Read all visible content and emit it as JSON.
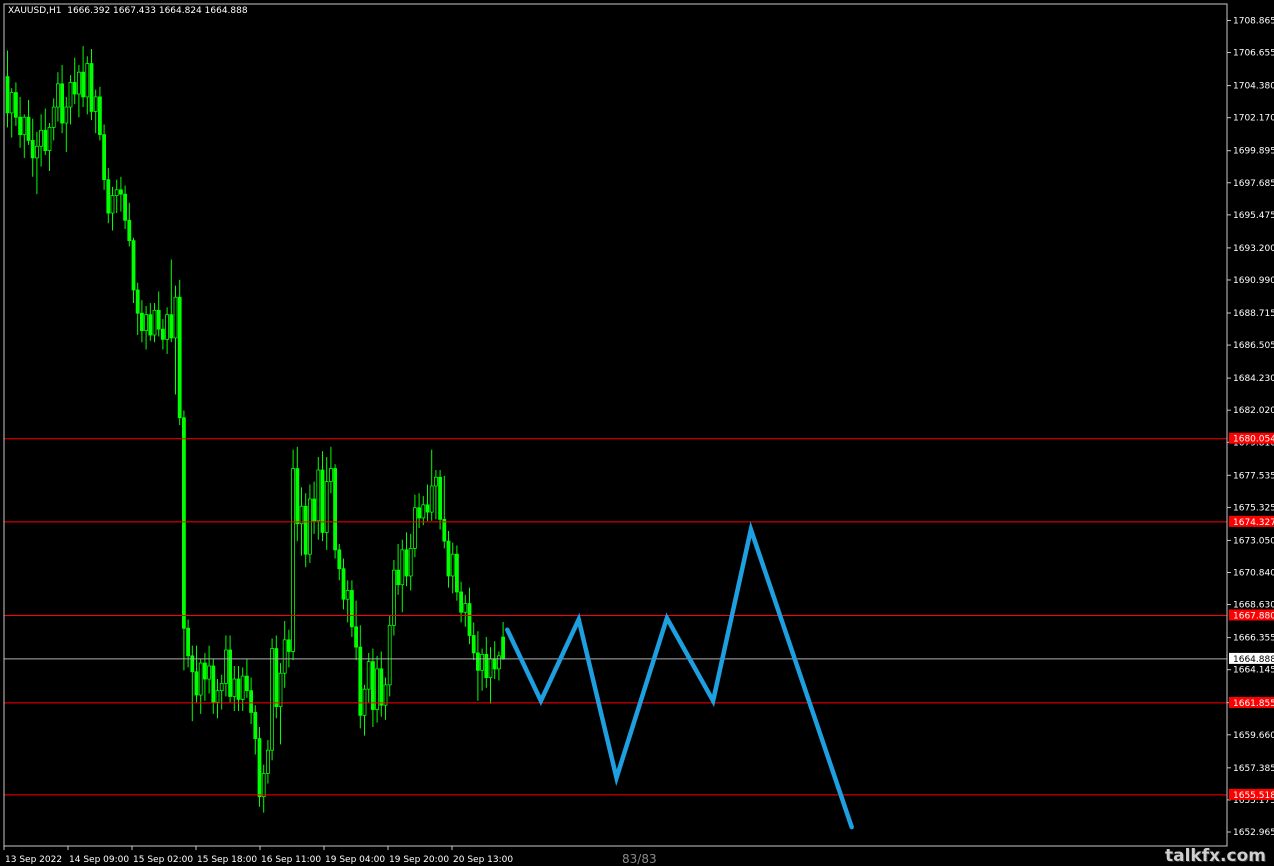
{
  "chart_data": {
    "type": "candlestick",
    "title": "XAUUSD,H1  1666.392 1667.433 1664.824 1664.888",
    "symbol": "XAUUSD,H1",
    "ohlc_label": "1666.392 1667.433 1664.824 1664.888",
    "ylim": [
      1652.0,
      1710.0
    ],
    "y_ticks": [
      "1708.865",
      "1706.655",
      "1704.380",
      "1702.170",
      "1699.895",
      "1697.685",
      "1695.475",
      "1693.200",
      "1690.990",
      "1688.715",
      "1686.505",
      "1684.230",
      "1682.020",
      "1679.810",
      "1677.535",
      "1675.325",
      "1673.050",
      "1670.840",
      "1668.630",
      "1666.355",
      "1664.145",
      "1661.870",
      "1659.660",
      "1657.385",
      "1655.175",
      "1652.965"
    ],
    "x_labels": [
      "13 Sep 2022",
      "14 Sep 09:00",
      "15 Sep 02:00",
      "15 Sep 18:00",
      "16 Sep 11:00",
      "19 Sep 04:00",
      "19 Sep 20:00",
      "20 Sep 13:00"
    ],
    "current_price": "1664.888",
    "levels": [
      "1680.054",
      "1674.327",
      "1667.880",
      "1661.855",
      "1655.518"
    ],
    "colors": {
      "background": "#000000",
      "candles": "#00ff00",
      "levels": "#ff0000",
      "label_bg": "#ff0000",
      "current": "#b0b0b0",
      "projection": "#1e9fe0"
    },
    "projection_path": [
      {
        "bar": 119,
        "price": 1666.9
      },
      {
        "bar": 127,
        "price": 1662.0
      },
      {
        "bar": 136,
        "price": 1667.6
      },
      {
        "bar": 145,
        "price": 1656.7
      },
      {
        "bar": 157,
        "price": 1667.7
      },
      {
        "bar": 168,
        "price": 1662.0
      },
      {
        "bar": 177,
        "price": 1673.8
      },
      {
        "bar": 201,
        "price": 1653.3
      }
    ],
    "candles": [
      [
        1705.0,
        1706.8,
        1701.5,
        1702.5
      ],
      [
        1702.5,
        1704.2,
        1700.8,
        1703.9
      ],
      [
        1703.9,
        1704.6,
        1701.6,
        1702.2
      ],
      [
        1702.2,
        1703.6,
        1700.1,
        1701.0
      ],
      [
        1701.0,
        1702.4,
        1699.4,
        1702.2
      ],
      [
        1702.2,
        1703.4,
        1700.3,
        1700.6
      ],
      [
        1700.6,
        1702.1,
        1698.1,
        1699.4
      ],
      [
        1699.4,
        1701.2,
        1696.9,
        1700.2
      ],
      [
        1700.2,
        1702.4,
        1698.8,
        1701.3
      ],
      [
        1701.3,
        1702.8,
        1699.6,
        1699.9
      ],
      [
        1699.9,
        1701.8,
        1698.5,
        1701.5
      ],
      [
        1701.5,
        1703.5,
        1700.6,
        1702.9
      ],
      [
        1702.9,
        1705.3,
        1701.9,
        1704.5
      ],
      [
        1704.5,
        1705.8,
        1701.1,
        1701.8
      ],
      [
        1701.8,
        1703.6,
        1699.8,
        1702.9
      ],
      [
        1702.9,
        1705.1,
        1701.7,
        1704.6
      ],
      [
        1704.6,
        1706.3,
        1703.1,
        1703.8
      ],
      [
        1703.8,
        1705.8,
        1702.2,
        1705.3
      ],
      [
        1705.3,
        1707.1,
        1702.9,
        1703.6
      ],
      [
        1703.6,
        1706.4,
        1702.4,
        1705.9
      ],
      [
        1705.9,
        1706.9,
        1702.0,
        1702.6
      ],
      [
        1702.6,
        1704.1,
        1701.1,
        1703.6
      ],
      [
        1703.6,
        1704.3,
        1700.6,
        1701.0
      ],
      [
        1701.0,
        1701.7,
        1697.2,
        1697.9
      ],
      [
        1697.9,
        1698.7,
        1694.9,
        1695.6
      ],
      [
        1695.6,
        1697.4,
        1694.4,
        1696.8
      ],
      [
        1696.8,
        1697.9,
        1695.6,
        1697.2
      ],
      [
        1697.2,
        1698.1,
        1695.7,
        1696.9
      ],
      [
        1696.9,
        1697.5,
        1694.5,
        1695.1
      ],
      [
        1695.1,
        1696.3,
        1693.3,
        1693.7
      ],
      [
        1693.7,
        1693.9,
        1689.4,
        1690.3
      ],
      [
        1690.3,
        1690.8,
        1687.2,
        1688.7
      ],
      [
        1688.7,
        1689.6,
        1686.7,
        1687.5
      ],
      [
        1687.5,
        1689.2,
        1686.2,
        1688.6
      ],
      [
        1688.6,
        1689.4,
        1686.8,
        1687.2
      ],
      [
        1687.2,
        1689.4,
        1686.7,
        1688.9
      ],
      [
        1688.9,
        1690.2,
        1687.1,
        1687.6
      ],
      [
        1687.6,
        1688.3,
        1686.2,
        1686.9
      ],
      [
        1686.9,
        1689.1,
        1685.9,
        1688.6
      ],
      [
        1688.6,
        1692.4,
        1686.7,
        1687.0
      ],
      [
        1687.0,
        1690.6,
        1683.1,
        1689.8
      ],
      [
        1689.8,
        1691.0,
        1681.0,
        1681.5
      ],
      [
        1681.5,
        1682.0,
        1664.1,
        1667.0
      ],
      [
        1667.0,
        1667.6,
        1664.3,
        1665.1
      ],
      [
        1665.1,
        1665.8,
        1660.6,
        1664.0
      ],
      [
        1664.0,
        1665.8,
        1661.9,
        1662.4
      ],
      [
        1662.4,
        1664.9,
        1661.1,
        1664.6
      ],
      [
        1664.6,
        1665.3,
        1662.0,
        1663.5
      ],
      [
        1663.5,
        1665.8,
        1662.5,
        1664.4
      ],
      [
        1664.4,
        1664.9,
        1661.1,
        1661.9
      ],
      [
        1661.9,
        1663.5,
        1660.8,
        1662.7
      ],
      [
        1662.7,
        1663.8,
        1661.4,
        1663.2
      ],
      [
        1663.2,
        1666.5,
        1662.3,
        1665.5
      ],
      [
        1665.5,
        1666.5,
        1661.9,
        1662.3
      ],
      [
        1662.3,
        1664.4,
        1661.3,
        1663.5
      ],
      [
        1663.5,
        1664.4,
        1661.3,
        1662.1
      ],
      [
        1662.1,
        1664.3,
        1661.3,
        1663.7
      ],
      [
        1663.7,
        1664.9,
        1662.2,
        1662.7
      ],
      [
        1662.7,
        1663.6,
        1660.4,
        1661.2
      ],
      [
        1661.2,
        1661.7,
        1658.3,
        1659.4
      ],
      [
        1659.4,
        1660.2,
        1654.7,
        1655.4
      ],
      [
        1655.4,
        1657.6,
        1654.3,
        1657.0
      ],
      [
        1657.0,
        1659.3,
        1656.3,
        1658.6
      ],
      [
        1658.6,
        1666.3,
        1657.9,
        1665.6
      ],
      [
        1665.6,
        1666.5,
        1660.8,
        1661.6
      ],
      [
        1661.6,
        1664.6,
        1659.0,
        1663.9
      ],
      [
        1663.9,
        1667.5,
        1662.9,
        1666.2
      ],
      [
        1666.2,
        1666.9,
        1664.3,
        1665.4
      ],
      [
        1665.4,
        1679.3,
        1664.8,
        1678.0
      ],
      [
        1678.0,
        1679.5,
        1673.0,
        1674.2
      ],
      [
        1674.2,
        1676.7,
        1672.0,
        1675.4
      ],
      [
        1675.4,
        1676.3,
        1671.2,
        1672.1
      ],
      [
        1672.1,
        1676.9,
        1671.5,
        1675.9
      ],
      [
        1675.9,
        1677.1,
        1673.5,
        1674.4
      ],
      [
        1674.4,
        1678.8,
        1673.1,
        1677.9
      ],
      [
        1677.9,
        1679.2,
        1673.0,
        1673.6
      ],
      [
        1673.6,
        1678.8,
        1672.4,
        1677.1
      ],
      [
        1677.1,
        1679.5,
        1676.3,
        1678.0
      ],
      [
        1678.0,
        1678.3,
        1671.8,
        1672.4
      ],
      [
        1672.4,
        1672.8,
        1670.3,
        1671.1
      ],
      [
        1671.1,
        1671.8,
        1668.3,
        1669.0
      ],
      [
        1669.0,
        1670.3,
        1667.4,
        1669.6
      ],
      [
        1669.6,
        1670.3,
        1666.4,
        1667.1
      ],
      [
        1667.1,
        1668.9,
        1664.8,
        1665.7
      ],
      [
        1665.7,
        1667.2,
        1660.1,
        1661.0
      ],
      [
        1661.0,
        1663.1,
        1659.6,
        1662.8
      ],
      [
        1662.8,
        1665.3,
        1661.9,
        1664.7
      ],
      [
        1664.7,
        1665.6,
        1660.2,
        1661.4
      ],
      [
        1661.4,
        1665.1,
        1660.5,
        1664.2
      ],
      [
        1664.2,
        1665.4,
        1660.9,
        1661.7
      ],
      [
        1661.7,
        1663.6,
        1660.7,
        1663.1
      ],
      [
        1663.1,
        1667.9,
        1662.3,
        1667.2
      ],
      [
        1667.2,
        1671.7,
        1666.5,
        1671.0
      ],
      [
        1671.0,
        1672.8,
        1669.3,
        1670.0
      ],
      [
        1670.0,
        1673.1,
        1668.1,
        1672.4
      ],
      [
        1672.4,
        1673.6,
        1669.9,
        1670.6
      ],
      [
        1670.6,
        1673.5,
        1669.6,
        1672.5
      ],
      [
        1672.5,
        1676.2,
        1671.9,
        1675.3
      ],
      [
        1675.3,
        1676.3,
        1673.9,
        1674.6
      ],
      [
        1674.6,
        1676.1,
        1674.1,
        1675.5
      ],
      [
        1675.5,
        1676.9,
        1674.4,
        1675.0
      ],
      [
        1675.0,
        1679.3,
        1674.4,
        1676.8
      ],
      [
        1676.8,
        1677.9,
        1674.5,
        1677.4
      ],
      [
        1677.4,
        1677.9,
        1673.8,
        1674.5
      ],
      [
        1674.5,
        1677.5,
        1672.5,
        1673.0
      ],
      [
        1673.0,
        1673.7,
        1669.8,
        1670.6
      ],
      [
        1670.6,
        1672.9,
        1669.4,
        1672.1
      ],
      [
        1672.1,
        1672.7,
        1668.9,
        1669.5
      ],
      [
        1669.5,
        1670.2,
        1667.4,
        1668.1
      ],
      [
        1668.1,
        1669.3,
        1667.1,
        1668.7
      ],
      [
        1668.7,
        1669.8,
        1665.9,
        1666.5
      ],
      [
        1666.5,
        1667.4,
        1664.8,
        1665.3
      ],
      [
        1665.3,
        1666.8,
        1662.0,
        1664.1
      ],
      [
        1664.1,
        1665.6,
        1662.7,
        1665.2
      ],
      [
        1665.2,
        1666.4,
        1662.9,
        1663.6
      ],
      [
        1663.6,
        1665.7,
        1661.8,
        1664.9
      ],
      [
        1664.9,
        1666.1,
        1663.5,
        1664.2
      ],
      [
        1664.2,
        1665.4,
        1663.4,
        1665.1
      ],
      [
        1666.392,
        1667.433,
        1664.824,
        1664.888
      ]
    ]
  },
  "page_counter": "83/83",
  "watermark": "talkfx.com"
}
